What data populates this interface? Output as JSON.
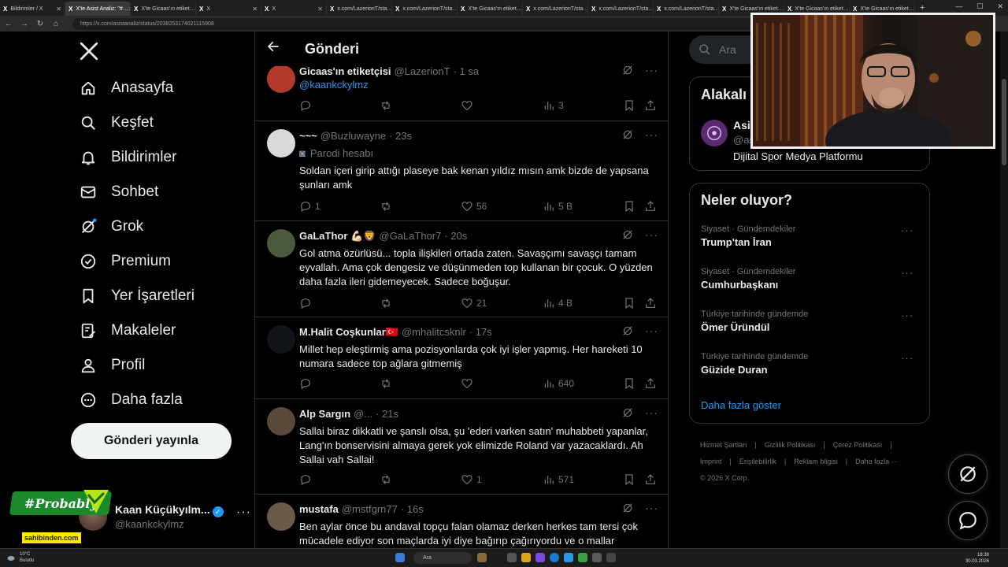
{
  "browser": {
    "tabs": [
      {
        "label": "Bildirimler / X",
        "active": false
      },
      {
        "label": "X'te Asist Analiz: \"#…",
        "active": true
      },
      {
        "label": "X'te Gicaas'ın etiket…",
        "active": false
      },
      {
        "label": "X",
        "active": false
      },
      {
        "label": "X",
        "active": false
      },
      {
        "label": "x.com/LazerionT/sta…",
        "active": false
      },
      {
        "label": "x.com/LazerionT/sta…",
        "active": false
      },
      {
        "label": "X'te Gicaas'ın etiket…",
        "active": false
      },
      {
        "label": "x.com/LazerionT/sta…",
        "active": false
      },
      {
        "label": "x.com/LazerionT/sta…",
        "active": false
      },
      {
        "label": "x.com/LazerionT/sta…",
        "active": false
      },
      {
        "label": "X'te Gicaas'ın etiket…",
        "active": false
      },
      {
        "label": "X'te Gicaas'ın etiket…",
        "active": false
      },
      {
        "label": "X'te Gicaas'ın etiket…",
        "active": false
      }
    ],
    "url": "https://x.com/asistanaliz/status/2038253174021115908"
  },
  "nav": {
    "items": [
      {
        "label": "Anasayfa",
        "icon": "home-icon"
      },
      {
        "label": "Keşfet",
        "icon": "search-icon"
      },
      {
        "label": "Bildirimler",
        "icon": "bell-icon"
      },
      {
        "label": "Sohbet",
        "icon": "mail-icon"
      },
      {
        "label": "Grok",
        "icon": "grok-icon"
      },
      {
        "label": "Premium",
        "icon": "premium-icon"
      },
      {
        "label": "Yer İşaretleri",
        "icon": "bookmark-icon"
      },
      {
        "label": "Makaleler",
        "icon": "article-icon"
      },
      {
        "label": "Profil",
        "icon": "profile-icon"
      },
      {
        "label": "Daha fazla",
        "icon": "more-circle-icon"
      }
    ],
    "post_button": "Gönderi yayınla",
    "profile": {
      "name": "Kaan Küçükyılm...",
      "handle": "@kaankckylmz"
    }
  },
  "overlay": {
    "brand": "#Probably",
    "sponsor": "sahibinden.com"
  },
  "main": {
    "title": "Gönderi",
    "tweets": [
      {
        "name": "Gicaas'ın etiketçisi",
        "handle": "@LazerionT",
        "time": "· 1 sa",
        "text": "@kaankckylmz",
        "replies": "",
        "retweets": "",
        "likes": "",
        "views": "3",
        "avatar_color": "#b23a2a"
      },
      {
        "name": "~~~",
        "handle": "@Buzluwayne",
        "time": "· 23s",
        "badge": "Parodi hesabı",
        "text": "Soldan içeri girip attığı plaseye bak kenan yıldız mısın amk bizde de yapsana şunları amk",
        "replies": "1",
        "retweets": "",
        "likes": "56",
        "views": "5 B",
        "avatar_color": "#d9d9d9"
      },
      {
        "name": "GaLaThor 💪🏻🦁",
        "handle": "@GaLaThor7",
        "time": "· 20s",
        "text": "Gol atma özürlüsü... topla ilişkileri ortada zaten. Savaşçımı savaşçı tamam eyvallah. Ama çok dengesiz ve düşünmeden top kullanan bir çocuk. O yüzden daha fazla ileri gidemeyecek. Sadece boğuşur.",
        "replies": "",
        "retweets": "",
        "likes": "21",
        "views": "4 B",
        "avatar_color": "#4a5a3a"
      },
      {
        "name": "M.Halit Coşkunlar🇹🇷",
        "handle": "@mhalitcsknlr",
        "time": "· 17s",
        "text": "Millet hep eleştirmiş ama pozisyonlarda çok iyi işler yapmış. Her hareketi 10 numara sadece top ağlara gitmemiş",
        "replies": "",
        "retweets": "",
        "likes": "",
        "views": "640",
        "avatar_color": "#111418"
      },
      {
        "name": "Alp Sargın",
        "handle": "@...",
        "time": "· 21s",
        "text": "Sallai biraz dikkatli ve şanslı olsa, şu 'ederi varken satın' muhabbeti yapanlar, Lang'ın bonservisini almaya gerek yok elimizde Roland var yazacaklardı. Ah Sallai vah Sallai!",
        "replies": "",
        "retweets": "",
        "likes": "1",
        "views": "571",
        "avatar_color": "#5a4a3a"
      },
      {
        "name": "mustafa",
        "handle": "@mstfgrn77",
        "time": "· 16s",
        "text": "Ben aylar önce bu andaval topçu falan olamaz derken herkes tam tersi çok mücadele ediyor son maçlarda iyi diye bağırıp çağırıyordu ve o mallar",
        "replies": "",
        "retweets": "",
        "likes": "",
        "views": "",
        "avatar_color": "#6a5a4a"
      }
    ]
  },
  "sidebar": {
    "search_placeholder": "Ara",
    "related": {
      "title": "Alakalı",
      "name": "Asi",
      "handle": "@as",
      "description": "Dijital Spor Medya Platformu"
    },
    "trends": {
      "title": "Neler oluyor?",
      "items": [
        {
          "category": "Siyaset · Gündemdekiler",
          "title": "Trump'tan İran"
        },
        {
          "category": "Siyaset · Gündemdekiler",
          "title": "Cumhurbaşkanı"
        },
        {
          "category": "Türkiye tarihinde gündemde",
          "title": "Ömer Üründül"
        },
        {
          "category": "Türkiye tarihinde gündemde",
          "title": "Güzide Duran"
        }
      ],
      "show_more": "Daha fazla göster"
    },
    "footer": [
      "Hizmet Şartları",
      "|",
      "Gizlilik Politikası",
      "|",
      "Çerez Politikası",
      "|",
      "Imprint",
      "|",
      "Erişilebilirlik",
      "|",
      "Reklam bilgisi",
      "|",
      "Daha fazla ···",
      "© 2026 X Corp."
    ]
  },
  "taskbar": {
    "weather_temp": "10°C",
    "weather_desc": "Bulutlu",
    "search": "Ara",
    "time": "18:38",
    "date": "30.03.2026"
  },
  "colors": {
    "accent": "#1d9bf0",
    "background": "#000000",
    "border": "#2f3336",
    "muted": "#71767b"
  }
}
